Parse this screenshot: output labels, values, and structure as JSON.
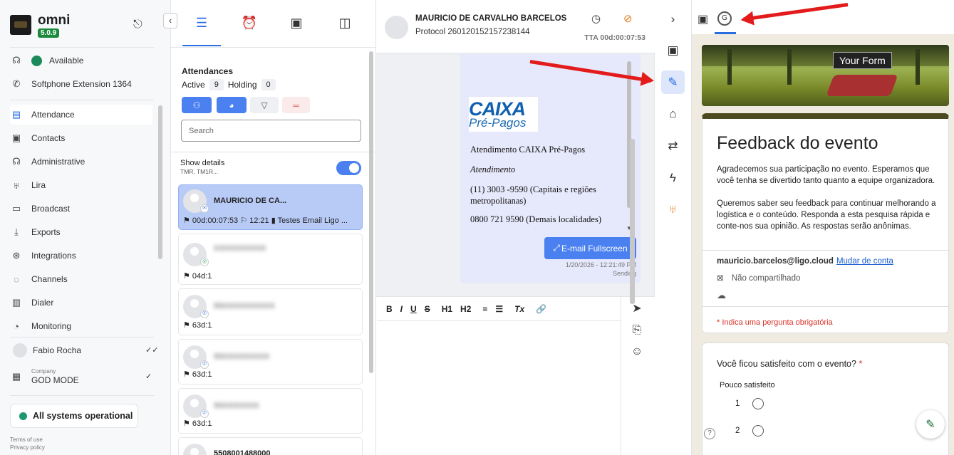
{
  "app": {
    "brand": "omni",
    "version": "5.0.9"
  },
  "sidebar": {
    "status": "Available",
    "softphone": "Softphone Extension 1364",
    "items": [
      {
        "label": "Attendance",
        "icon": "chat-icon"
      },
      {
        "label": "Contacts",
        "icon": "contacts-icon"
      },
      {
        "label": "Administrative",
        "icon": "admin-icon"
      },
      {
        "label": "Lira",
        "icon": "lira-icon"
      },
      {
        "label": "Broadcast",
        "icon": "broadcast-icon"
      },
      {
        "label": "Exports",
        "icon": "download-icon"
      },
      {
        "label": "Integrations",
        "icon": "integrations-icon"
      },
      {
        "label": "Channels",
        "icon": "channels-icon"
      },
      {
        "label": "Dialer",
        "icon": "dialer-icon"
      },
      {
        "label": "Monitoring",
        "icon": "monitoring-icon"
      }
    ],
    "user": "Fabio Rocha",
    "company_label": "Company",
    "company": "GOD MODE",
    "system_status": "All systems operational",
    "terms": "Terms of use",
    "privacy": "Privacy policy"
  },
  "attendances": {
    "title": "Attendances",
    "active_label": "Active",
    "active_count": "9",
    "holding_label": "Holding",
    "holding_count": "0",
    "search_placeholder": "Search",
    "show_details": "Show details",
    "show_details_sub": "TMR, TM1R...",
    "cards": [
      {
        "name": "MAURICIO DE CA...",
        "meta": "⚑ 00d:00:07:53  ⚐ 12:21  ▮ Testes Email Ligo ...",
        "channel": "email"
      },
      {
        "name": "XXXXXXXXXX",
        "meta": "⚑ 04d:1",
        "channel": "whatsapp"
      },
      {
        "name": "55XXXXXXXXXX",
        "meta": "⚑ 63d:1",
        "channel": "phone"
      },
      {
        "name": "55XXXXXXXXX",
        "meta": "⚑ 63d:1",
        "channel": "phone"
      },
      {
        "name": "55XXXXXXX",
        "meta": "⚑ 63d:1",
        "channel": "phone"
      },
      {
        "name": "5508001488000",
        "meta": "",
        "channel": "phone"
      }
    ]
  },
  "conversation": {
    "contact_name": "MAURICIO DE CARVALHO BARCELOS",
    "protocol": "Protocol 260120152157238144",
    "tta": "TTA 00d:00:07:53",
    "message": {
      "logo_top": "CAIXA",
      "logo_bottom": "Pré-Pagos",
      "line1": "Atendimento CAIXA Pré-Pagos",
      "line2": "Atendimento",
      "line3": "(11) 3003 -9590 (Capitais e regiões metropolitanas)",
      "line4": "0800 721 9590 (Demais localidades)",
      "fullscreen_label": "E-mail Fullscreen",
      "timestamp": "1/20/2026 - 12:21:49 PM",
      "status": "Sending"
    },
    "editor_tools": [
      "B",
      "I",
      "U",
      "S",
      "H1",
      "H2",
      "≡",
      "☰",
      "Tx",
      "🔗"
    ]
  },
  "form": {
    "banner_label": "Your Form",
    "title": "Feedback do evento",
    "description": "Agradecemos sua participação no evento. Esperamos que você tenha se divertido tanto quanto a equipe organizadora.",
    "description2": "Queremos saber seu feedback para continuar melhorando a logística e o conteúdo. Responda a esta pesquisa rápida e conte-nos sua opinião. As respostas serão anônimas.",
    "email": "mauricio.barcelos@ligo.cloud",
    "switch_account": "Mudar de conta",
    "not_shared": "Não compartilhado",
    "required_note": "* Indica uma pergunta obrigatória",
    "question": "Você ficou satisfeito com o evento?",
    "required_star": "*",
    "scale_low": "Pouco satisfeito",
    "options": [
      "1",
      "2"
    ]
  }
}
